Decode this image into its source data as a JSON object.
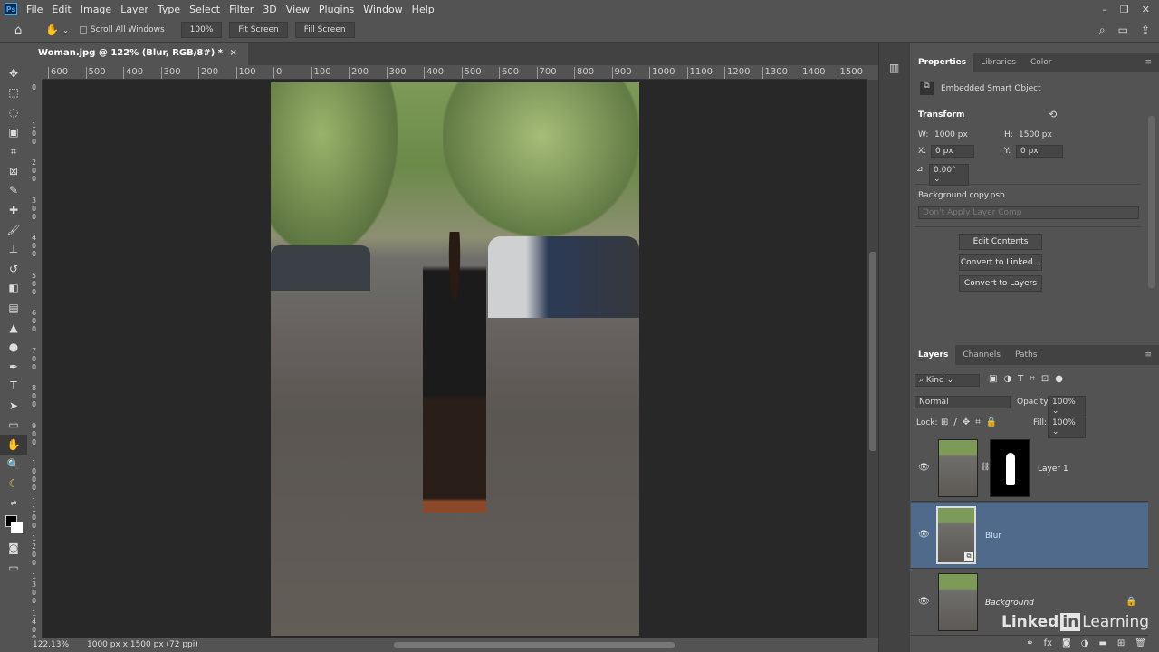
{
  "app": {
    "logo": "Ps"
  },
  "menu": [
    "File",
    "Edit",
    "Image",
    "Layer",
    "Type",
    "Select",
    "Filter",
    "3D",
    "View",
    "Plugins",
    "Window",
    "Help"
  ],
  "options": {
    "scroll_all_windows": "Scroll All Windows",
    "zoom": "100%",
    "fit_screen": "Fit Screen",
    "fill_screen": "Fill Screen"
  },
  "document_tab": {
    "title": "Woman.jpg @ 122% (Blur, RGB/8#) *",
    "close": "×"
  },
  "ruler_h": [
    "600",
    "500",
    "400",
    "300",
    "200",
    "100",
    "0",
    "100",
    "200",
    "300",
    "400",
    "500",
    "600",
    "700",
    "800",
    "900",
    "1000",
    "1100",
    "1200",
    "1300",
    "1400",
    "1500"
  ],
  "ruler_v": [
    "0",
    "100",
    "200",
    "300",
    "400",
    "500",
    "600",
    "700",
    "800",
    "900",
    "1000",
    "1100",
    "1200",
    "1300",
    "1400"
  ],
  "status": {
    "zoom": "122.13%",
    "doc_info": "1000 px x 1500 px (72 ppi)"
  },
  "properties": {
    "tabs": [
      "Properties",
      "Libraries",
      "Color"
    ],
    "type": "Embedded Smart Object",
    "transform_label": "Transform",
    "w_label": "W:",
    "w": "1000 px",
    "h_label": "H:",
    "h": "1500 px",
    "x_label": "X:",
    "x": "0 px",
    "y_label": "Y:",
    "y": "0 px",
    "angle": "0.00°",
    "source": "Background copy.psb",
    "layer_comp": "Don't Apply Layer Comp",
    "buttons": [
      "Edit Contents",
      "Convert to Linked...",
      "Convert to Layers"
    ]
  },
  "layers": {
    "tabs": [
      "Layers",
      "Channels",
      "Paths"
    ],
    "filter": "Kind",
    "blend_mode": "Normal",
    "opacity_label": "Opacity:",
    "opacity": "100%",
    "lock_label": "Lock:",
    "fill_label": "Fill:",
    "fill": "100%",
    "items": [
      {
        "name": "Layer 1"
      },
      {
        "name": "Blur"
      },
      {
        "name": "Background"
      }
    ]
  },
  "watermark": {
    "brand": "Linked",
    "brand_in": "in",
    "brand_suffix": "Learning"
  }
}
